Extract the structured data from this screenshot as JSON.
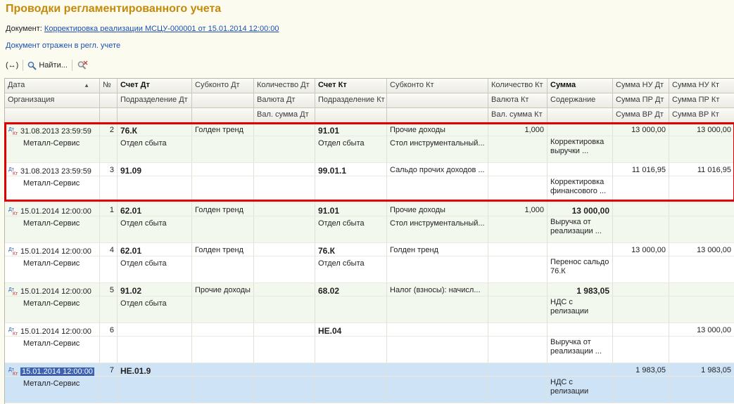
{
  "title": "Проводки регламентированного учета",
  "document": {
    "label": "Документ:",
    "link": "Корректировка реализации МСЦУ-000001 от 15.01.2014 12:00:00"
  },
  "reflected_text": "Документ отражен в регл. учете",
  "toolbar": {
    "expand_label": "(↔)",
    "find_label": "Найти...",
    "find_icon": "magnifier-icon",
    "cancel_find_icon": "cancel-search-icon"
  },
  "columns": {
    "row1": [
      "Дата",
      "№",
      "Счет Дт",
      "Субконто Дт",
      "Количество Дт",
      "Счет Кт",
      "Субконто Кт",
      "Количество Кт",
      "Сумма",
      "Сумма НУ Дт",
      "Сумма НУ Кт"
    ],
    "row2": [
      "Организация",
      "",
      "Подразделение Дт",
      "",
      "Валюта Дт",
      "Подразделение Кт",
      "",
      "Валюта Кт",
      "Содержание",
      "Сумма ПР Дт",
      "Сумма ПР Кт"
    ],
    "row3": [
      "",
      "",
      "",
      "",
      "Вал. сумма Дт",
      "",
      "",
      "Вал. сумма Кт",
      "",
      "Сумма ВР Дт",
      "Сумма ВР Кт"
    ]
  },
  "rows": [
    {
      "date": "31.08.2013 23:59:59",
      "num": "2",
      "org": "Металл-Сервис",
      "acc_dt": "76.К",
      "div_dt": "Отдел сбыта",
      "sub_dt": "Голден тренд",
      "qty_dt": "",
      "acc_kt": "91.01",
      "div_kt": "Отдел сбыта",
      "sub_kt1": "Прочие доходы",
      "sub_kt2": "Стол инструментальный...",
      "qty_kt": "1,000",
      "sum": "",
      "content": "Корректировка выручки ...",
      "nu_dt": "13 000,00",
      "nu_kt": "13 000,00"
    },
    {
      "date": "31.08.2013 23:59:59",
      "num": "3",
      "org": "Металл-Сервис",
      "acc_dt": "91.09",
      "div_dt": "",
      "sub_dt": "",
      "qty_dt": "",
      "acc_kt": "99.01.1",
      "div_kt": "",
      "sub_kt1": "Сальдо прочих доходов ...",
      "sub_kt2": "",
      "qty_kt": "",
      "sum": "",
      "content": "Корректировка финансового ...",
      "nu_dt": "11 016,95",
      "nu_kt": "11 016,95"
    },
    {
      "date": "15.01.2014 12:00:00",
      "num": "1",
      "org": "Металл-Сервис",
      "acc_dt": "62.01",
      "div_dt": "Отдел сбыта",
      "sub_dt": "Голден тренд",
      "qty_dt": "",
      "acc_kt": "91.01",
      "div_kt": "Отдел сбыта",
      "sub_kt1": "Прочие доходы",
      "sub_kt2": "Стол инструментальный...",
      "qty_kt": "1,000",
      "sum": "13 000,00",
      "content": "Выручка от реализации ...",
      "nu_dt": "",
      "nu_kt": ""
    },
    {
      "date": "15.01.2014 12:00:00",
      "num": "4",
      "org": "Металл-Сервис",
      "acc_dt": "62.01",
      "div_dt": "Отдел сбыта",
      "sub_dt": "Голден тренд",
      "qty_dt": "",
      "acc_kt": "76.К",
      "div_kt": "Отдел сбыта",
      "sub_kt1": "Голден тренд",
      "sub_kt2": "",
      "qty_kt": "",
      "sum": "",
      "content": "Перенос сальдо 76.К",
      "nu_dt": "13 000,00",
      "nu_kt": "13 000,00"
    },
    {
      "date": "15.01.2014 12:00:00",
      "num": "5",
      "org": "Металл-Сервис",
      "acc_dt": "91.02",
      "div_dt": "Отдел сбыта",
      "sub_dt": "Прочие доходы",
      "qty_dt": "",
      "acc_kt": "68.02",
      "div_kt": "",
      "sub_kt1": "Налог (взносы): начисл...",
      "sub_kt2": "",
      "qty_kt": "",
      "sum": "1 983,05",
      "content": "НДС с релизации",
      "nu_dt": "",
      "nu_kt": ""
    },
    {
      "date": "15.01.2014 12:00:00",
      "num": "6",
      "org": "Металл-Сервис",
      "acc_dt": "",
      "div_dt": "",
      "sub_dt": "",
      "qty_dt": "",
      "acc_kt": "НЕ.04",
      "div_kt": "",
      "sub_kt1": "",
      "sub_kt2": "",
      "qty_kt": "",
      "sum": "",
      "content": "Выручка от реализации ...",
      "nu_dt": "",
      "nu_kt": "13 000,00"
    },
    {
      "date": "15.01.2014 12:00:00",
      "num": "7",
      "org": "Металл-Сервис",
      "acc_dt": "НЕ.01.9",
      "div_dt": "",
      "sub_dt": "",
      "qty_dt": "",
      "acc_kt": "",
      "div_kt": "",
      "sub_kt1": "",
      "sub_kt2": "",
      "qty_kt": "",
      "sum": "",
      "content": "НДС с релизации",
      "nu_dt": "1 983,05",
      "nu_kt": "1 983,05"
    }
  ],
  "selected_row": 6,
  "highlight_color": "#e00000",
  "selection_color": "#cfe3f7",
  "title_color": "#c48a0a"
}
